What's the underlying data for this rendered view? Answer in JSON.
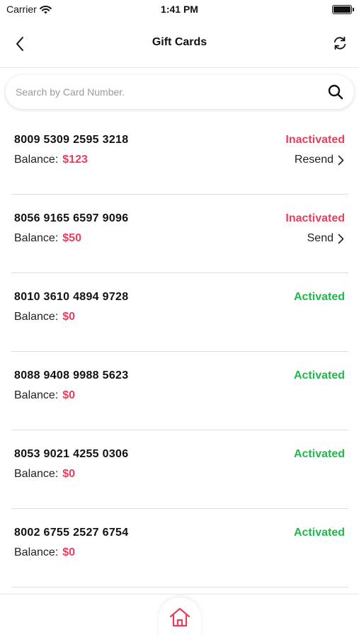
{
  "status_bar": {
    "carrier": "Carrier",
    "time": "1:41 PM",
    "wifi_icon": "wifi-icon",
    "battery_icon": "battery-icon"
  },
  "nav": {
    "title": "Gift Cards",
    "back_icon": "chevron-left-icon",
    "refresh_icon": "refresh-icon"
  },
  "search": {
    "placeholder": "Search by Card Number.",
    "value": "",
    "icon": "search-icon"
  },
  "balance_label": "Balance:",
  "colors": {
    "accent": "#e83e5c",
    "activated": "#1fb84a",
    "inactivated": "#e83e5c"
  },
  "cards": [
    {
      "number": "8009 5309 2595 3218",
      "balance": "$123",
      "status": "Inactivated",
      "action": "Resend"
    },
    {
      "number": "8056 9165 6597 9096",
      "balance": "$50",
      "status": "Inactivated",
      "action": "Send"
    },
    {
      "number": "8010 3610 4894 9728",
      "balance": "$0",
      "status": "Activated",
      "action": ""
    },
    {
      "number": "8088 9408 9988 5623",
      "balance": "$0",
      "status": "Activated",
      "action": ""
    },
    {
      "number": "8053 9021 4255 0306",
      "balance": "$0",
      "status": "Activated",
      "action": ""
    },
    {
      "number": "8002 6755 2527 6754",
      "balance": "$0",
      "status": "Activated",
      "action": ""
    }
  ],
  "bottom_nav": {
    "home_icon": "home-icon"
  }
}
